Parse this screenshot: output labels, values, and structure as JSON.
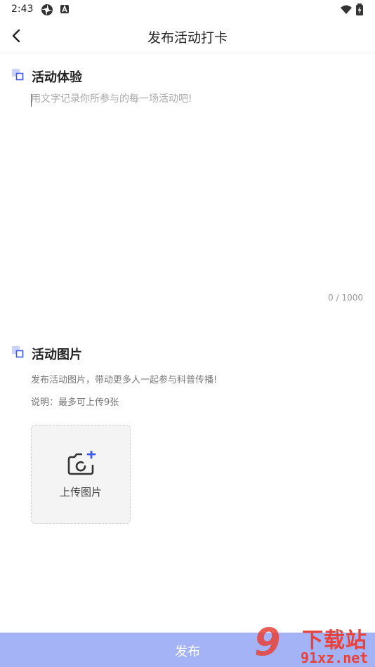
{
  "status_bar": {
    "time": "2:43",
    "icons": [
      "pinwheel-icon",
      "a-notification-icon",
      "wifi-icon",
      "battery-charging-icon"
    ]
  },
  "nav": {
    "title": "发布活动打卡",
    "back_icon": "chevron-left-icon"
  },
  "experience": {
    "title": "活动体验",
    "placeholder": "用文字记录你所参与的每一场活动吧!",
    "value": "",
    "char_count": "0 / 1000"
  },
  "photos": {
    "title": "活动图片",
    "description": "发布活动图片，带动更多人一起参与科普传播!",
    "note": "说明：最多可上传9张",
    "upload_label": "上传图片",
    "upload_icon": "camera-add-icon"
  },
  "publish": {
    "label": "发布"
  },
  "watermark": {
    "digits": "9",
    "top_text": "下载站",
    "bottom_text": "91xz.net"
  },
  "colors": {
    "accent": "#3d5af1",
    "marker_light": "#c9d3fb",
    "publish_bg": "#a3b3f5",
    "watermark": "#e8433a"
  }
}
